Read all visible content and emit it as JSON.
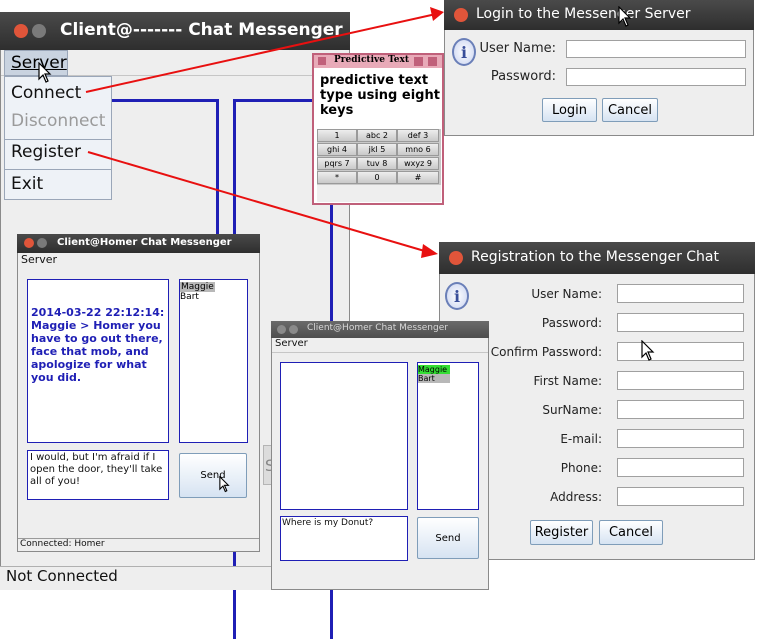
{
  "main_window": {
    "title": "Client@------- Chat Messenger",
    "menu": "Server",
    "menu_items": [
      "Connect",
      "Disconnect",
      "Register",
      "Exit"
    ],
    "status": "Not Connected"
  },
  "predictive": {
    "title": "Predictive Text",
    "text": "predictive text type using eight keys",
    "keys": [
      "1",
      "abc 2",
      "def 3",
      "ghi 4",
      "jkl 5",
      "mno 6",
      "pqrs 7",
      "tuv 8",
      "wxyz 9",
      "*",
      "0",
      "#"
    ]
  },
  "login": {
    "title": "Login to the Messenger Server",
    "user_label": "User Name:",
    "password_label": "Password:",
    "login_button": "Login",
    "cancel_button": "Cancel"
  },
  "registration": {
    "title": "Registration to the Messenger Chat",
    "fields": [
      "User Name:",
      "Password:",
      "Confirm Password:",
      "First Name:",
      "SurName:",
      "E-mail:",
      "Phone:",
      "Address:"
    ],
    "register_button": "Register",
    "cancel_button": "Cancel"
  },
  "homer1": {
    "title": "Client@Homer  Chat Messenger",
    "menu": "Server",
    "message": "2014-03-22 22:12:14: Maggie > Homer you have to go out there, face that mob, and apologize for what you did.",
    "users": [
      "Maggie",
      "Bart"
    ],
    "input": "I would, but I'm afraid if I open the door, they'll take all of you!",
    "send": "Send",
    "status": "Connected: Homer"
  },
  "homer2": {
    "title": "Client@Homer  Chat Messenger",
    "menu": "Server",
    "users": [
      "Maggie",
      "Bart"
    ],
    "input": "Where is my Donut?",
    "send": "Send"
  },
  "colors": {
    "arrow": "#e81010",
    "blue_text": "#1f1fb5",
    "user_selected_green": "#33dd33",
    "user_selected_gray": "#b8b8b8",
    "predictive_border": "#c0607a"
  }
}
